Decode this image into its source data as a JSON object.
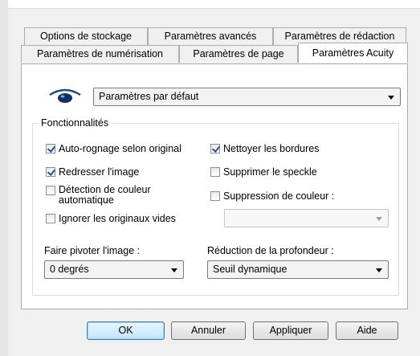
{
  "tabs": {
    "row1": [
      "Options de stockage",
      "Paramètres avancés",
      "Paramètres de rédaction"
    ],
    "row2": [
      "Paramètres de numérisation",
      "Paramètres de page",
      "Paramètres Acuity"
    ],
    "active": "Paramètres Acuity"
  },
  "preset": {
    "value": "Paramètres par défaut",
    "icon": "eye-icon"
  },
  "features": {
    "title": "Fonctionnalités",
    "auto_crop": {
      "label": "Auto-rognage selon original",
      "checked": true
    },
    "straighten": {
      "label": "Redresser l'image",
      "checked": true
    },
    "color_detect": {
      "label_line1": "Détection de couleur",
      "label_line2": "automatique",
      "checked": false
    },
    "ignore_blank": {
      "label": "Ignorer les originaux vides",
      "checked": false
    },
    "clean_borders": {
      "label": "Nettoyer les bordures",
      "checked": true
    },
    "remove_speckle": {
      "label": "Supprimer le speckle",
      "checked": false
    },
    "color_drop": {
      "label": "Suppression de couleur :",
      "checked": false
    },
    "color_drop_value": "",
    "rotate": {
      "label": "Faire pivoter l'image :",
      "value": "0 degrés"
    },
    "depth": {
      "label": "Réduction de la profondeur :",
      "value": "Seuil dynamique"
    }
  },
  "buttons": {
    "ok": "OK",
    "cancel": "Annuler",
    "apply": "Appliquer",
    "help": "Aide"
  }
}
